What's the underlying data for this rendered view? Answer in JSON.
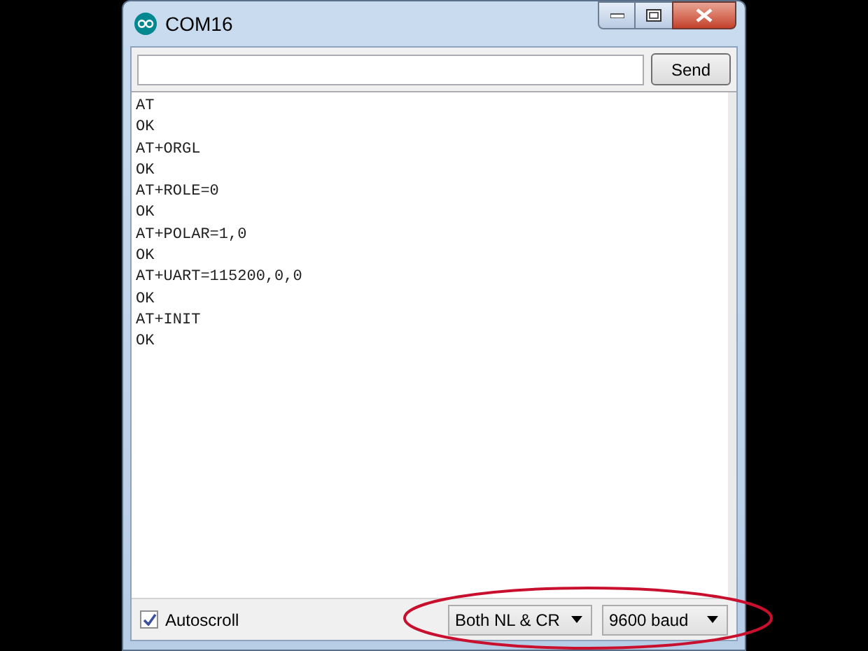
{
  "window": {
    "title": "COM16"
  },
  "input": {
    "button": "Send"
  },
  "output": [
    "AT",
    "OK",
    "AT+ORGL",
    "OK",
    "AT+ROLE=0",
    "OK",
    "AT+POLAR=1,0",
    "OK",
    "AT+UART=115200,0,0",
    "OK",
    "AT+INIT",
    "OK"
  ],
  "footer": {
    "autoscroll": {
      "label": "Autoscroll",
      "checked": true
    },
    "dropdowns": [
      {
        "value": "Both NL & CR"
      },
      {
        "value": "9600 baud"
      }
    ]
  }
}
